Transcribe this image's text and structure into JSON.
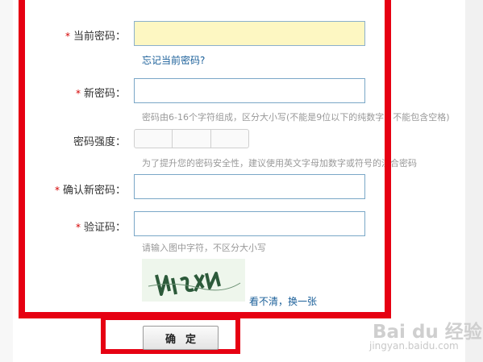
{
  "form": {
    "required_mark": "*",
    "current_password": {
      "label": "当前密码：",
      "value": ""
    },
    "forgot_link": "忘记当前密码?",
    "new_password": {
      "label": "新密码：",
      "value": ""
    },
    "new_password_hint": "密码由6-16个字符组成，区分大小写(不能是9位以下的纯数字，不能包含空格)",
    "strength": {
      "label": "密码强度：",
      "level": 0,
      "segments": 3
    },
    "strength_hint": "为了提升您的密码安全性，建议使用英文字母加数字或符号的混合密码",
    "confirm_password": {
      "label": "确认新密码：",
      "value": ""
    },
    "captcha": {
      "label": "验证码：",
      "value": ""
    },
    "captcha_hint": "请输入图中字符，不区分大小写",
    "captcha_refresh": "看不清，换一张",
    "submit_label": "确定"
  },
  "colors": {
    "highlight_frame": "#e60012",
    "required": "#d40000",
    "link": "#1a5f99",
    "input_border": "#7aa7c7",
    "focused_input_bg": "#fdf7c2"
  },
  "watermark": {
    "logo": "Bai du 经验",
    "url": "jingyan.baidu.com"
  }
}
